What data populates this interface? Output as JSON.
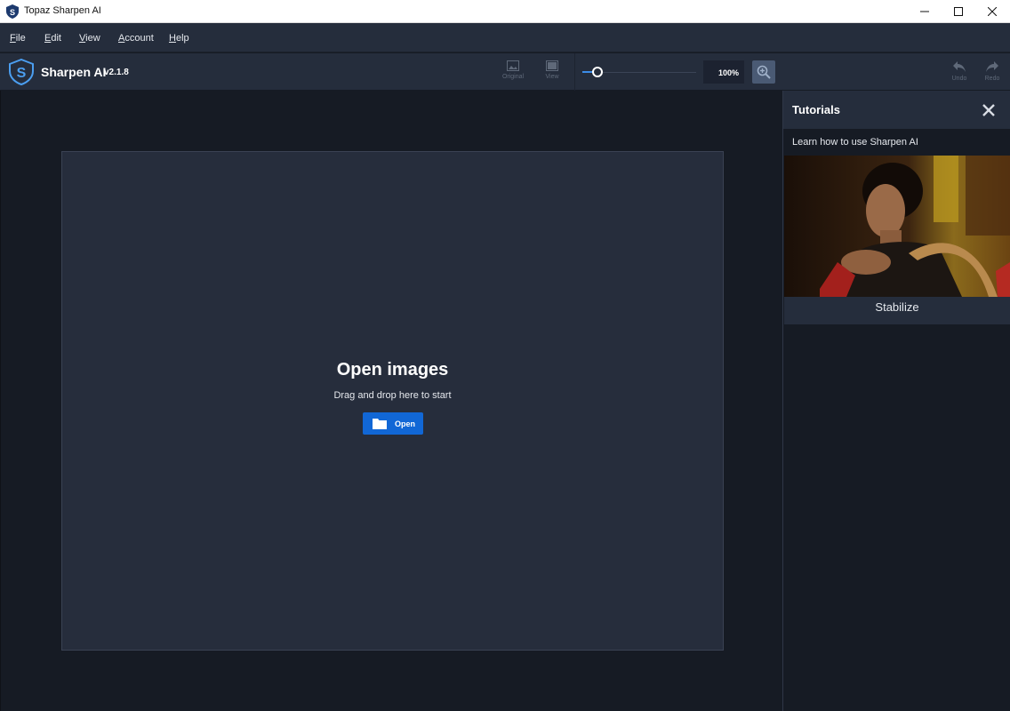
{
  "window": {
    "title": "Topaz Sharpen AI"
  },
  "menu": {
    "items": [
      "File",
      "Edit",
      "View",
      "Account",
      "Help"
    ]
  },
  "toolbar": {
    "app_name": "Sharpen AI",
    "version": "v2.1.8",
    "original_label": "Original",
    "view_label": "View",
    "zoom_value": "100%",
    "zoom_slider_level": 0.1,
    "undo_label": "Undo",
    "redo_label": "Redo"
  },
  "workspace": {
    "title": "Open images",
    "subtitle": "Drag and drop here to start",
    "open_button_label": "Open"
  },
  "tutorials": {
    "title": "Tutorials",
    "description": "Learn how to use Sharpen AI",
    "items": [
      {
        "label": "Stabilize"
      }
    ]
  },
  "colors": {
    "accent": "#1167d6",
    "panel_bg": "#252d3c",
    "workspace_bg": "#161b24",
    "dropzone_bg": "#262d3c"
  },
  "icons": {
    "app": "topaz-shield-icon",
    "original": "image-icon",
    "view": "split-view-icon",
    "zoom": "zoom-in-icon",
    "undo": "undo-arrow-icon",
    "redo": "redo-arrow-icon",
    "open": "folder-icon",
    "close": "close-x-icon"
  }
}
